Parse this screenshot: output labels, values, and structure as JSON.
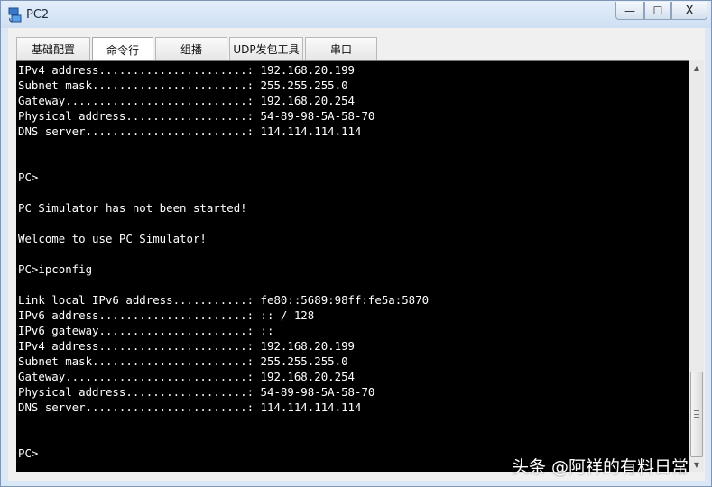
{
  "window": {
    "title": "PC2"
  },
  "controls": {
    "minimize": "—",
    "maximize": "☐",
    "close": "X"
  },
  "tabs": [
    {
      "label": "基础配置"
    },
    {
      "label": "命令行",
      "active": true
    },
    {
      "label": "组播"
    },
    {
      "label": "UDP发包工具"
    },
    {
      "label": "串口"
    }
  ],
  "terminal": {
    "lines": [
      "IPv4 address......................: 192.168.20.199",
      "Subnet mask.......................: 255.255.255.0",
      "Gateway...........................: 192.168.20.254",
      "Physical address..................: 54-89-98-5A-58-70",
      "DNS server........................: 114.114.114.114",
      "",
      "",
      "PC>",
      "",
      "PC Simulator has not been started!",
      "",
      "Welcome to use PC Simulator!",
      "",
      "PC>ipconfig",
      "",
      "Link local IPv6 address...........: fe80::5689:98ff:fe5a:5870",
      "IPv6 address......................: :: / 128",
      "IPv6 gateway......................: ::",
      "IPv4 address......................: 192.168.20.199",
      "Subnet mask.......................: 255.255.255.0",
      "Gateway...........................: 192.168.20.254",
      "Physical address..................: 54-89-98-5A-58-70",
      "DNS server........................: 114.114.114.114",
      "",
      "",
      "PC>"
    ]
  },
  "watermark": "头条 @阿祥的有料日常"
}
